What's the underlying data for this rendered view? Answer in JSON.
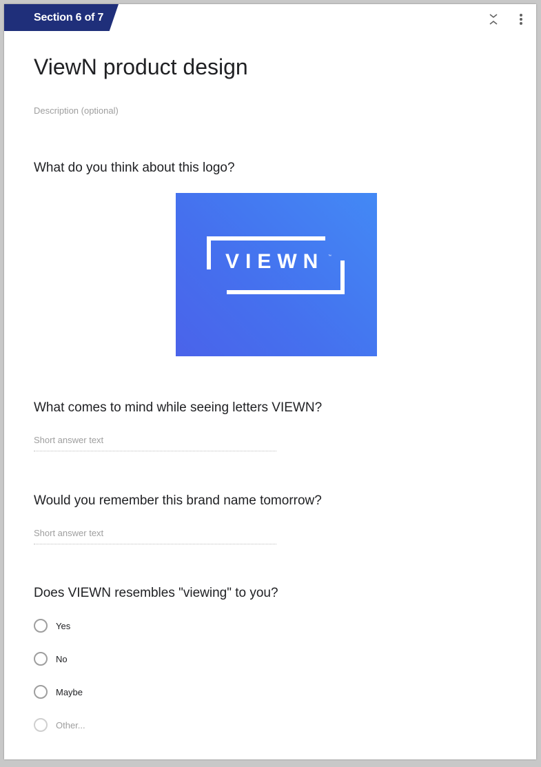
{
  "section": {
    "label": "Section 6 of 7"
  },
  "icons": {
    "collapse": "collapse-icon",
    "more": "more-vert-icon"
  },
  "form": {
    "title": "ViewN product design",
    "description_placeholder": "Description (optional)"
  },
  "questions": [
    {
      "title": "What do you think about this logo?",
      "type": "image"
    },
    {
      "title": "What comes to mind while seeing letters VIEWN?",
      "type": "short",
      "placeholder": "Short answer text"
    },
    {
      "title": "Would you remember this brand name tomorrow?",
      "type": "short",
      "placeholder": "Short answer text"
    },
    {
      "title": "Does VIEWN resembles \"viewing\" to you?",
      "type": "radio",
      "options": [
        "Yes",
        "No",
        "Maybe",
        "Other..."
      ]
    }
  ],
  "logo": {
    "text": "VIEWN",
    "tm": "™",
    "colors": {
      "start": "#4389f5",
      "end": "#4a63ea"
    }
  },
  "colors": {
    "section_tab": "#1f2f7a",
    "background": "#c8c8c8"
  }
}
